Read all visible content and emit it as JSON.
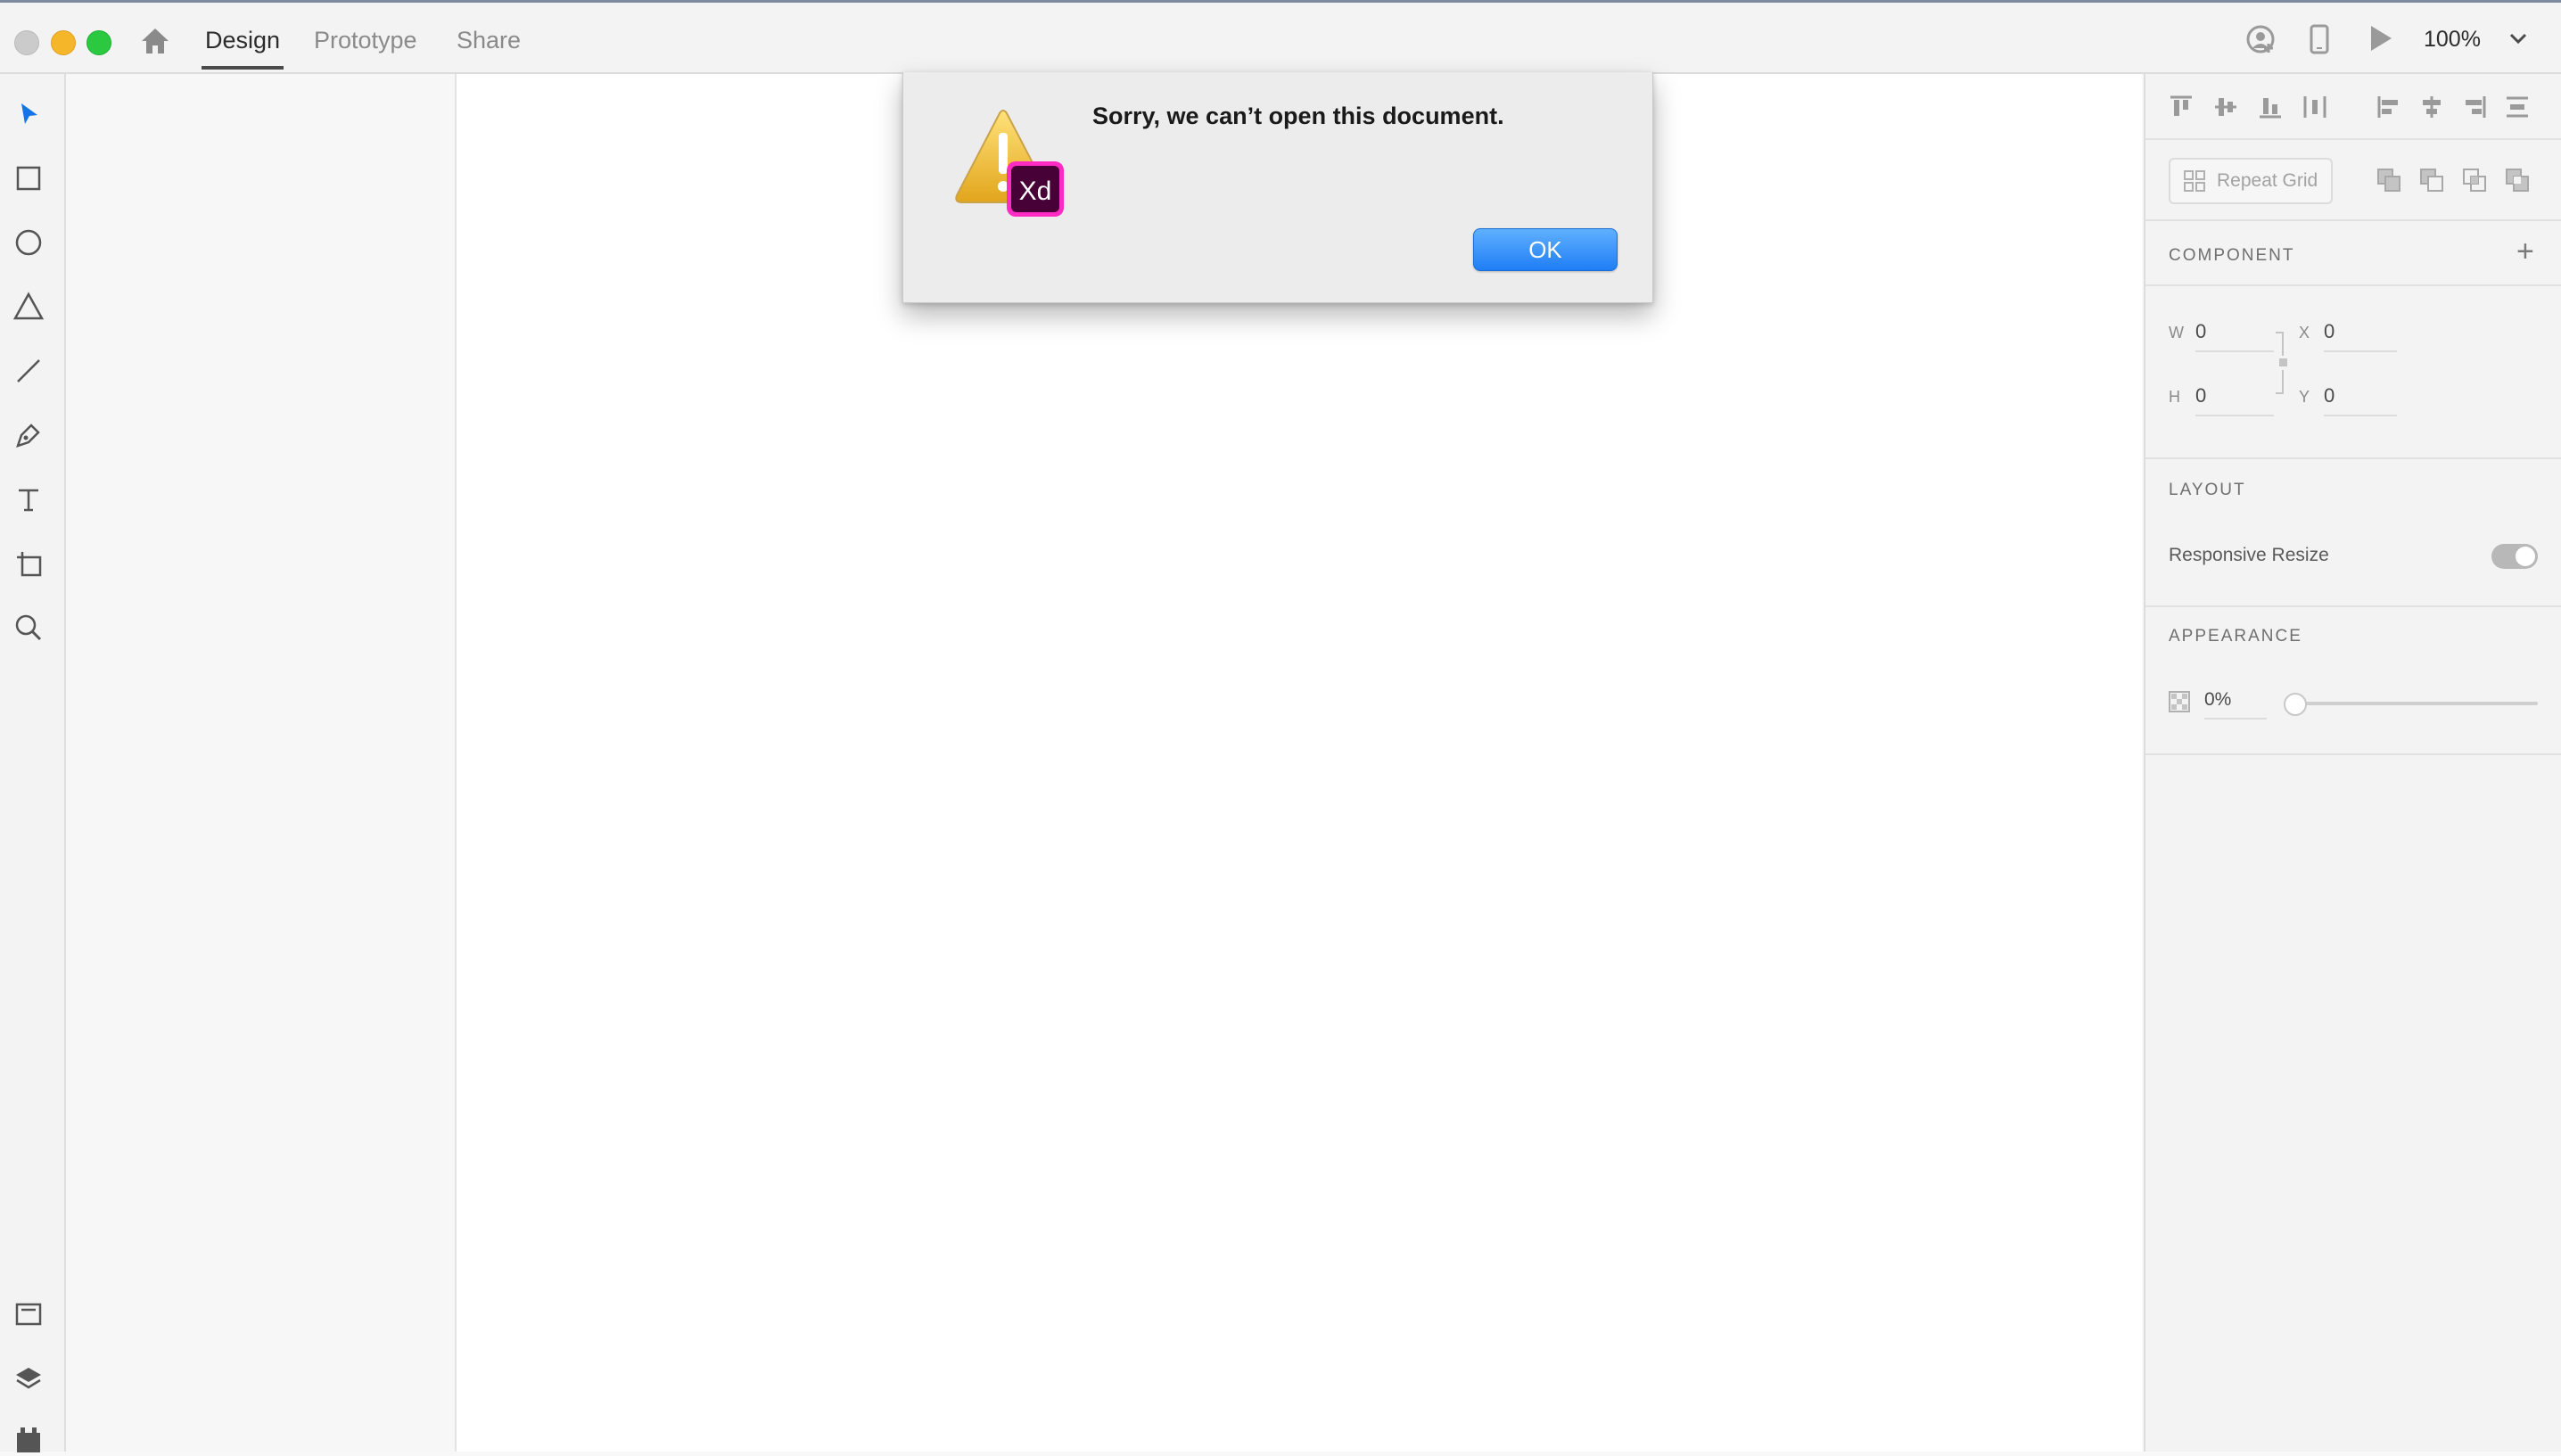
{
  "app": {
    "name": "Adobe XD",
    "accent_color": "#1473e6"
  },
  "header": {
    "tabs": [
      {
        "label": "Design",
        "active": true
      },
      {
        "label": "Prototype",
        "active": false
      },
      {
        "label": "Share",
        "active": false
      }
    ],
    "zoom": "100%",
    "icons": [
      "home-icon",
      "invite-user-icon",
      "device-preview-icon",
      "play-icon",
      "chevron-down-icon"
    ]
  },
  "left_toolbar": {
    "tools": [
      "select-tool",
      "rectangle-tool",
      "ellipse-tool",
      "polygon-tool",
      "line-tool",
      "pen-tool",
      "text-tool",
      "artboard-tool",
      "zoom-tool"
    ],
    "bottom_tools": [
      "assets-panel",
      "layers-panel",
      "plugins-panel"
    ],
    "active_tool": "select-tool"
  },
  "inspector": {
    "repeat_grid_label": "Repeat Grid",
    "component_title": "COMPONENT",
    "component_add": "+",
    "w_label": "W",
    "w_value": "0",
    "h_label": "H",
    "h_value": "0",
    "x_label": "X",
    "x_value": "0",
    "y_label": "Y",
    "y_value": "0",
    "layout_title": "LAYOUT",
    "responsive_resize_label": "Responsive Resize",
    "responsive_resize_on": true,
    "appearance_title": "APPEARANCE",
    "opacity_value": "0%",
    "opacity_fraction": 0
  },
  "dialog": {
    "message": "Sorry, we can’t open this document.",
    "ok_label": "OK",
    "icon_badge": "Xd",
    "badge_color": "#ff2bc2"
  }
}
